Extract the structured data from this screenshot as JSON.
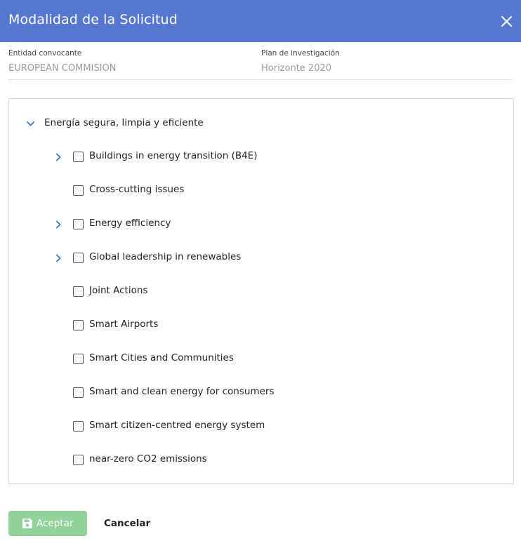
{
  "dialog": {
    "title": "Modalidad de la Solicitud",
    "close_icon": "close-icon"
  },
  "meta": {
    "entity_label": "Entidad convocante",
    "entity_value": "EUROPEAN COMMISION",
    "plan_label": "Plan de investigación",
    "plan_value": "Horizonte 2020"
  },
  "tree": {
    "root": {
      "label": "Energía segura, limpia y eficiente",
      "expanded": true,
      "icon": "chevron-down-icon"
    },
    "children": [
      {
        "label": "Buildings in energy transition (B4E)",
        "expandable": true,
        "checked": false
      },
      {
        "label": "Cross-cutting issues",
        "expandable": false,
        "checked": false
      },
      {
        "label": "Energy efficiency",
        "expandable": true,
        "checked": false
      },
      {
        "label": "Global leadership in renewables",
        "expandable": true,
        "checked": false
      },
      {
        "label": "Joint Actions",
        "expandable": false,
        "checked": false
      },
      {
        "label": "Smart Airports",
        "expandable": false,
        "checked": false
      },
      {
        "label": "Smart Cities and Communities",
        "expandable": false,
        "checked": false
      },
      {
        "label": "Smart and clean energy for consumers",
        "expandable": false,
        "checked": false
      },
      {
        "label": "Smart citizen-centred energy system",
        "expandable": false,
        "checked": false
      },
      {
        "label": "near-zero CO2 emissions",
        "expandable": false,
        "checked": false
      }
    ]
  },
  "footer": {
    "accept_label": "Aceptar",
    "accept_icon": "save-icon",
    "cancel_label": "Cancelar"
  },
  "colors": {
    "header_bg": "#5677d0",
    "chevron": "#4a6fc9",
    "accept_bg": "#8fd39a"
  }
}
